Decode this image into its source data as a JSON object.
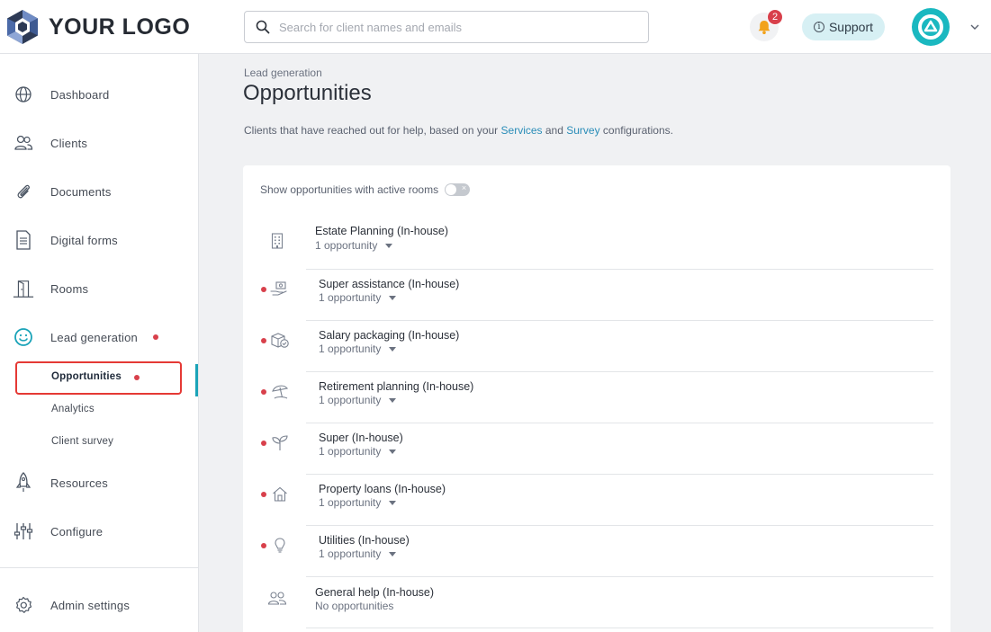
{
  "header": {
    "logo_text": "YOUR LOGO",
    "search_placeholder": "Search for client names and emails",
    "notifications_count": "2",
    "support_label": "Support"
  },
  "sidebar": {
    "items": [
      {
        "label": "Dashboard",
        "icon": "globe-icon"
      },
      {
        "label": "Clients",
        "icon": "users-icon"
      },
      {
        "label": "Documents",
        "icon": "paperclip-icon"
      },
      {
        "label": "Digital forms",
        "icon": "document-icon"
      },
      {
        "label": "Rooms",
        "icon": "door-icon"
      },
      {
        "label": "Lead generation",
        "icon": "smiley-icon"
      },
      {
        "label": "Resources",
        "icon": "rocket-icon"
      },
      {
        "label": "Configure",
        "icon": "sliders-icon"
      },
      {
        "label": "Admin settings",
        "icon": "gear-icon"
      }
    ],
    "sub_items": [
      {
        "label": "Opportunities",
        "active": true
      },
      {
        "label": "Analytics"
      },
      {
        "label": "Client survey"
      }
    ]
  },
  "main": {
    "breadcrumb": "Lead generation",
    "title": "Opportunities",
    "description_before": "Clients that have reached out for help, based on your ",
    "link_services": "Services",
    "description_and": " and ",
    "link_survey": "Survey",
    "description_after": " configurations.",
    "toggle_label": "Show opportunities with active rooms",
    "toggle_on": false,
    "opportunities": [
      {
        "name": "Estate Planning (In-house)",
        "count": "1 opportunity",
        "icon": "building-icon",
        "new": false
      },
      {
        "name": "Super assistance (In-house)",
        "count": "1 opportunity",
        "icon": "hand-coin-icon",
        "new": true
      },
      {
        "name": "Salary packaging (In-house)",
        "count": "1 opportunity",
        "icon": "package-check-icon",
        "new": true
      },
      {
        "name": "Retirement planning (In-house)",
        "count": "1 opportunity",
        "icon": "umbrella-icon",
        "new": true
      },
      {
        "name": "Super (In-house)",
        "count": "1 opportunity",
        "icon": "sprout-icon",
        "new": true
      },
      {
        "name": "Property loans (In-house)",
        "count": "1 opportunity",
        "icon": "house-icon",
        "new": true
      },
      {
        "name": "Utilities (In-house)",
        "count": "1 opportunity",
        "icon": "lightbulb-icon",
        "new": true
      },
      {
        "name": "General help (In-house)",
        "count": "No opportunities",
        "icon": "people-icon",
        "new": false
      }
    ]
  },
  "colors": {
    "accent": "#1aa3b8",
    "alert": "#d8404b",
    "link": "#2a8db8",
    "support_bg": "#d7f0f4"
  }
}
